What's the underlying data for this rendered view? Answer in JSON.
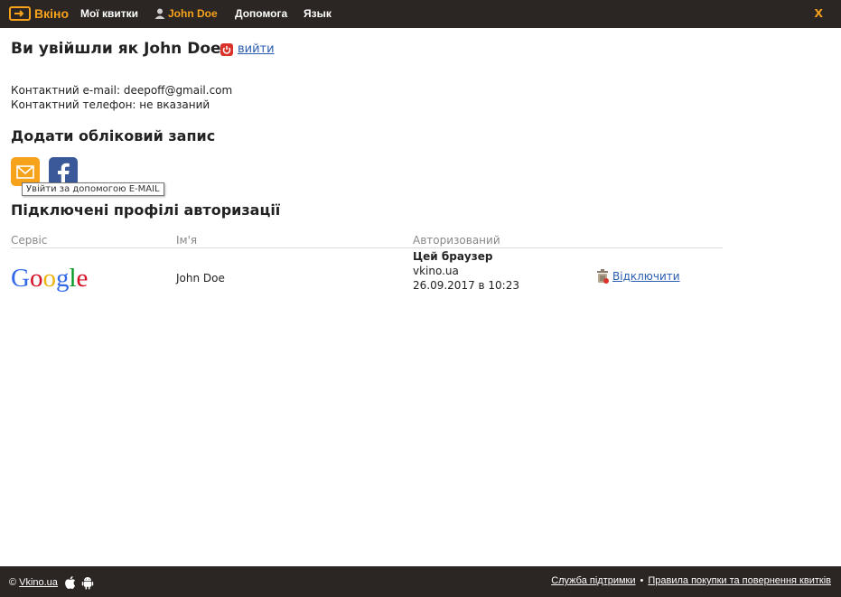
{
  "header": {
    "logo_text": "Вкіно",
    "nav_tickets": "Мої квитки",
    "nav_user": "John Doe",
    "nav_help": "Допомога",
    "nav_language": "Язык",
    "close": "x"
  },
  "account": {
    "title": "Ви увійшли як John Doe",
    "logout_label": "вийти",
    "email_line": "Контактний e-mail: deepoff@gmail.com",
    "phone_line": "Контактний телефон: не вказаний"
  },
  "add_account": {
    "heading": "Додати обліковий запис",
    "tooltip": "Увійти за допомогою E-MAIL"
  },
  "profiles": {
    "heading": "Підключені профілі авторизації",
    "columns": [
      "Сервіс",
      "Ім'я",
      "Авторизований"
    ],
    "rows": [
      {
        "service_logo": "Google",
        "name": "John Doe",
        "auth_title": "Цей браузер",
        "auth_site": "vkino.ua",
        "auth_date": "26.09.2017 в 10:23",
        "action": "Відключити"
      }
    ]
  },
  "footer": {
    "copyright_symbol": "©",
    "site_link": "Vkino.ua",
    "support_link": "Служба підтримки",
    "bullet": "•",
    "rules_link": "Правила покупки та повернення квитків"
  },
  "colors": {
    "bar_background": "#2b2523",
    "accent": "#f7a21b",
    "link": "#2a5db0",
    "facebook": "#3b5998"
  }
}
